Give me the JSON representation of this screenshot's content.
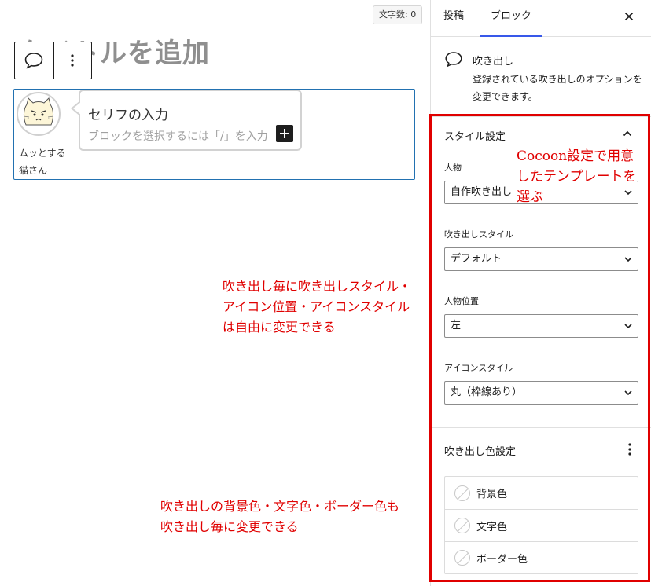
{
  "editor": {
    "word_count": "文字数: 0",
    "title_placeholder": "タイトルを追加",
    "balloon": {
      "avatar_name": "ムッとする猫さん",
      "text": "セリフの入力",
      "placeholder": "ブロックを選択するには「/」を入力"
    },
    "toolbar": {
      "balloon_icon": "speech-bubble-icon",
      "more_icon": "kebab-vertical-icon"
    }
  },
  "annotations": {
    "per_balloon_style": [
      "吹き出し毎に吹き出しスタイル・",
      "アイコン位置・アイコンスタイル",
      "は自由に変更できる"
    ],
    "per_balloon_color": [
      "吹き出しの背景色・文字色・ボーダー色も",
      "吹き出し毎に変更できる"
    ],
    "cocoon_template": [
      "Cocoon設定で用意",
      "したテンプレートを",
      "選ぶ"
    ]
  },
  "colors": {
    "annotation_red": "#e00000",
    "accent_blue": "#3858e9",
    "block_border": "#2271b1"
  },
  "sidebar": {
    "tabs": [
      {
        "label": "投稿"
      },
      {
        "label": "ブロック",
        "active": true
      }
    ],
    "close_icon": "close-icon",
    "block_card": {
      "title": "吹き出し",
      "description": "登録されている吹き出しのオプションを変更できます。"
    },
    "style_panel": {
      "title": "スタイル設定",
      "fields": [
        {
          "label": "人物",
          "value": "自作吹き出し"
        },
        {
          "label": "吹き出しスタイル",
          "value": "デフォルト"
        },
        {
          "label": "人物位置",
          "value": "左"
        },
        {
          "label": "アイコンスタイル",
          "value": "丸（枠線あり）"
        }
      ]
    },
    "color_panel": {
      "title": "吹き出し色設定",
      "items": [
        {
          "label": "背景色"
        },
        {
          "label": "文字色"
        },
        {
          "label": "ボーダー色"
        }
      ]
    }
  }
}
